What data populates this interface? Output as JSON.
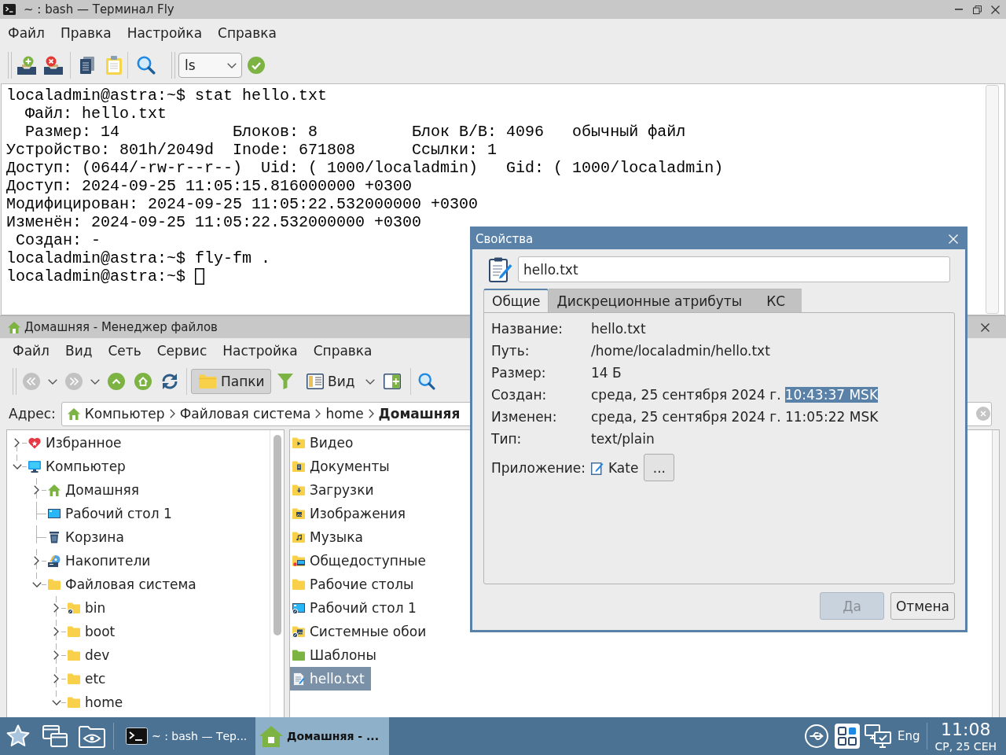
{
  "terminal": {
    "title": "~ : bash — Терминал Fly",
    "menu": [
      "Файл",
      "Правка",
      "Настройка",
      "Справка"
    ],
    "command_box": {
      "value": "ls"
    },
    "lines": [
      "localadmin@astra:~$ stat hello.txt",
      "  Файл: hello.txt",
      "  Размер: 14            Блоков: 8          Блок В/В: 4096   обычный файл",
      "Устройство: 801h/2049d  Inode: 671808      Ссылки: 1",
      "Доступ: (0644/-rw-r--r--)  Uid: ( 1000/localadmin)   Gid: ( 1000/localadmin)",
      "Доступ: 2024-09-25 11:05:15.816000000 +0300",
      "Модифицирован: 2024-09-25 11:05:22.532000000 +0300",
      "Изменён: 2024-09-25 11:05:22.532000000 +0300",
      " Создан: -",
      "localadmin@astra:~$ fly-fm .",
      "localadmin@astra:~$"
    ]
  },
  "file_manager": {
    "title": "Домашняя - Менеджер файлов",
    "menu": [
      "Файл",
      "Вид",
      "Сеть",
      "Сервис",
      "Настройка",
      "Справка"
    ],
    "folders_button": {
      "label": "Папки",
      "pressed": true
    },
    "view_button": {
      "label": "Вид"
    },
    "address": {
      "label": "Адрес:",
      "crumbs": [
        {
          "text": "Компьютер",
          "current": false
        },
        {
          "text": "Файловая система",
          "current": false
        },
        {
          "text": "home",
          "current": false
        },
        {
          "text": "Домашняя",
          "current": true
        }
      ]
    },
    "tree": [
      {
        "label": "Избранное",
        "kind": "favorites",
        "expanded": false
      },
      {
        "label": "Компьютер",
        "kind": "computer",
        "expanded": true,
        "children": [
          {
            "label": "Домашняя",
            "kind": "home",
            "expanded": false
          },
          {
            "label": "Рабочий стол 1",
            "kind": "desktop"
          },
          {
            "label": "Корзина",
            "kind": "trash"
          },
          {
            "label": "Накопители",
            "kind": "drives",
            "expanded": false
          },
          {
            "label": "Файловая система",
            "kind": "folder",
            "expanded": true,
            "children": [
              {
                "label": "bin",
                "kind": "link",
                "expanded": false
              },
              {
                "label": "boot",
                "kind": "folder",
                "expanded": false
              },
              {
                "label": "dev",
                "kind": "folder",
                "expanded": false
              },
              {
                "label": "etc",
                "kind": "folder",
                "expanded": false
              },
              {
                "label": "home",
                "kind": "folder",
                "expanded": true
              }
            ]
          }
        ]
      }
    ],
    "files": [
      {
        "label": "Видео",
        "kind": "video",
        "selected": false
      },
      {
        "label": "Документы",
        "kind": "documents",
        "selected": false
      },
      {
        "label": "Загрузки",
        "kind": "downloads",
        "selected": false
      },
      {
        "label": "Изображения",
        "kind": "pictures",
        "selected": false
      },
      {
        "label": "Музыка",
        "kind": "music",
        "selected": false
      },
      {
        "label": "Общедоступные",
        "kind": "public",
        "selected": false
      },
      {
        "label": "Рабочие столы",
        "kind": "folder",
        "selected": false
      },
      {
        "label": "Рабочий стол 1",
        "kind": "desktop",
        "selected": false
      },
      {
        "label": "Системные обои",
        "kind": "wallpapers",
        "selected": false
      },
      {
        "label": "Шаблоны",
        "kind": "templates",
        "selected": false
      },
      {
        "label": "hello.txt",
        "kind": "text",
        "selected": true
      }
    ]
  },
  "properties": {
    "title": "Свойства",
    "name": "hello.txt",
    "tabs": [
      {
        "label": "Общие",
        "selected": true
      },
      {
        "label": "Дискреционные атрибуты",
        "selected": false
      },
      {
        "label": "КС",
        "selected": false
      }
    ],
    "rows": [
      {
        "label": "Название:",
        "segments": [
          {
            "text": "hello.txt",
            "selected": false
          }
        ]
      },
      {
        "label": "Путь:",
        "segments": [
          {
            "text": "/home/localadmin/hello.txt",
            "selected": false
          }
        ]
      },
      {
        "label": "Размер:",
        "segments": [
          {
            "text": "14 Б",
            "selected": false
          }
        ]
      },
      {
        "label": "Создан:",
        "segments": [
          {
            "text": "среда, 25 сентября 2024 г.",
            "selected": false
          },
          {
            "text": "10:43:37 MSK",
            "selected": true
          }
        ]
      },
      {
        "label": "Изменен:",
        "segments": [
          {
            "text": "среда, 25 сентября 2024 г. 11:05:22 MSK",
            "selected": false
          }
        ]
      },
      {
        "label": "Тип:",
        "segments": [
          {
            "text": "text/plain",
            "selected": false
          }
        ]
      }
    ],
    "application": {
      "label": "Приложение:",
      "value": "Kate",
      "button": "..."
    },
    "buttons": [
      {
        "label": "Да",
        "disabled": true
      },
      {
        "label": "Отмена",
        "disabled": false
      }
    ]
  },
  "taskbar": {
    "tasks": [
      {
        "label": "~ : bash — Тер...",
        "kind": "terminal",
        "selected": false
      },
      {
        "label": "Домашняя - ...",
        "kind": "folder",
        "selected": true
      }
    ],
    "language": "Eng",
    "time": "11:08",
    "date": "СР, 25 СЕН"
  }
}
